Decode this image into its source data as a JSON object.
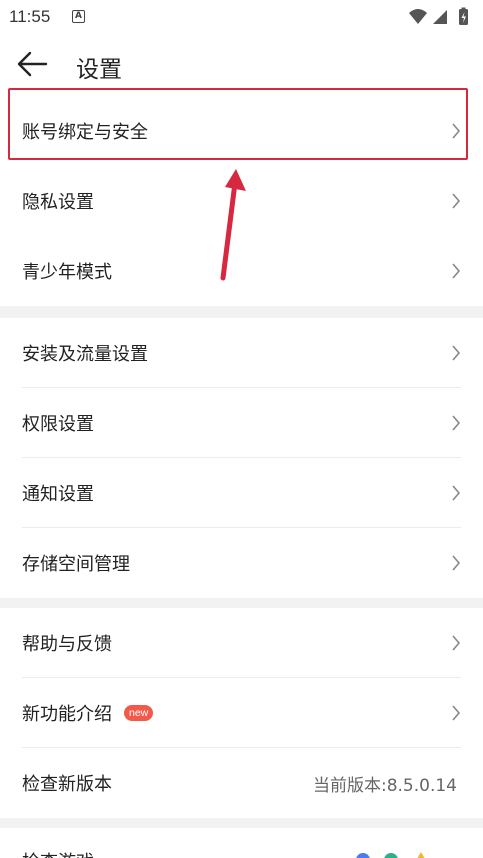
{
  "status_bar": {
    "time": "11:55",
    "notification_icon": "A"
  },
  "header": {
    "title": "设置"
  },
  "sections": [
    {
      "items": [
        {
          "label": "账号绑定与安全",
          "highlighted": true
        },
        {
          "label": "隐私设置"
        },
        {
          "label": "青少年模式"
        }
      ]
    },
    {
      "items": [
        {
          "label": "安装及流量设置"
        },
        {
          "label": "权限设置"
        },
        {
          "label": "通知设置"
        },
        {
          "label": "存储空间管理"
        }
      ]
    },
    {
      "items": [
        {
          "label": "帮助与反馈"
        },
        {
          "label": "新功能介绍",
          "badge": "new"
        },
        {
          "label": "检查新版本",
          "value": "当前版本:8.5.0.14"
        }
      ]
    }
  ],
  "peek_row": {
    "label": "检查游戏..."
  },
  "colors": {
    "highlight": "#d6293f",
    "badge": "#f15a4a",
    "section_gap": "#f2f2f2"
  }
}
